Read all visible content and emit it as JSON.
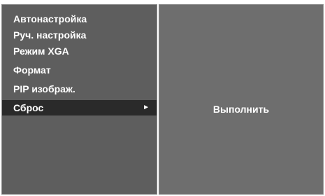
{
  "menu": {
    "items": [
      {
        "label": "Автонастройка",
        "selected": false
      },
      {
        "label": "Руч. настройка",
        "selected": false
      },
      {
        "label": "Режим XGA",
        "selected": false
      },
      {
        "label": "Формат",
        "selected": false
      },
      {
        "label": "PIP изображ.",
        "selected": false
      },
      {
        "label": "Сброс",
        "selected": true
      }
    ],
    "submenu_arrow_icon": "triangle-right-icon"
  },
  "submenu": {
    "action_label": "Выполнить"
  },
  "colors": {
    "panel_left": "#5e5e5e",
    "panel_right": "#6e6e6e",
    "highlight": "#2a2a2a",
    "text": "#ffffff"
  }
}
